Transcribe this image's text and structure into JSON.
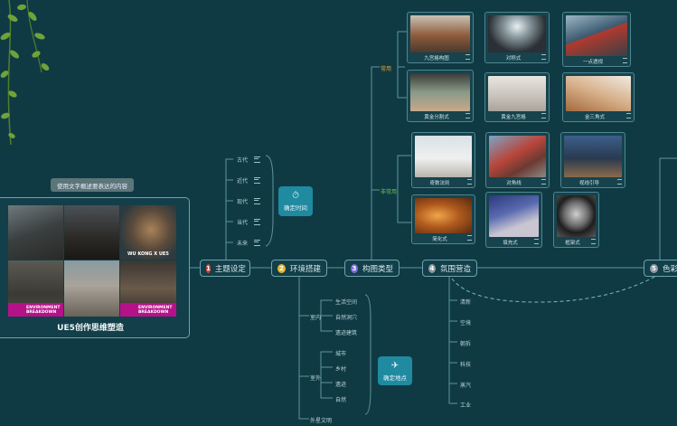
{
  "main_nodes": [
    {
      "num": "1",
      "label": "主题设定",
      "color": "#d9443b"
    },
    {
      "num": "2",
      "label": "环境搭建",
      "color": "#e6b52b"
    },
    {
      "num": "3",
      "label": "构图类型",
      "color": "#7b6ce0"
    },
    {
      "num": "4",
      "label": "氛围营造",
      "color": "#8f9aa1"
    },
    {
      "num": "5",
      "label": "色彩",
      "color": "#8f9aa1"
    }
  ],
  "subject_card": {
    "tooltip": "使用文字概述要表达的内容",
    "title": "UE5创作思维塑造",
    "wukong_text": "WU KONG X UE5",
    "env_text": "ENVIRONMENT",
    "breakdown_text": "BREAKDOWN"
  },
  "time_items": [
    "古代",
    "近代",
    "现代",
    "当代",
    "未来"
  ],
  "time_tag": "确定时间",
  "place_tag": "确定地点",
  "indoor_label": "室内",
  "indoor_items": [
    "生活空间",
    "自然洞穴",
    "遗迹建筑"
  ],
  "outdoor_label": "室外",
  "outdoor_items": [
    "城市",
    "乡村",
    "遗迹",
    "自然"
  ],
  "extra_item": "外星文明",
  "common_label": "常用",
  "uncommon_label": "非常用",
  "composition_cards": [
    {
      "label": "九宫格构图"
    },
    {
      "label": "对称式"
    },
    {
      "label": "一点透视"
    },
    {
      "label": "黄金分割式"
    },
    {
      "label": "黄金九宫格"
    },
    {
      "label": "金三角式"
    },
    {
      "label": "奇数法则"
    },
    {
      "label": "对角线"
    },
    {
      "label": "视线引导"
    },
    {
      "label": "简化式"
    },
    {
      "label": "填充式"
    },
    {
      "label": "框架式"
    }
  ],
  "mood_items": [
    "清新",
    "空境",
    "朝拆",
    "科技",
    "蒸汽",
    "工业"
  ],
  "colors": {
    "bg": "#0f3a44",
    "line": "#6fa3ab",
    "accent": "#1f8aa0",
    "common": "#e8a23a",
    "uncommon": "#6fbf5b"
  }
}
